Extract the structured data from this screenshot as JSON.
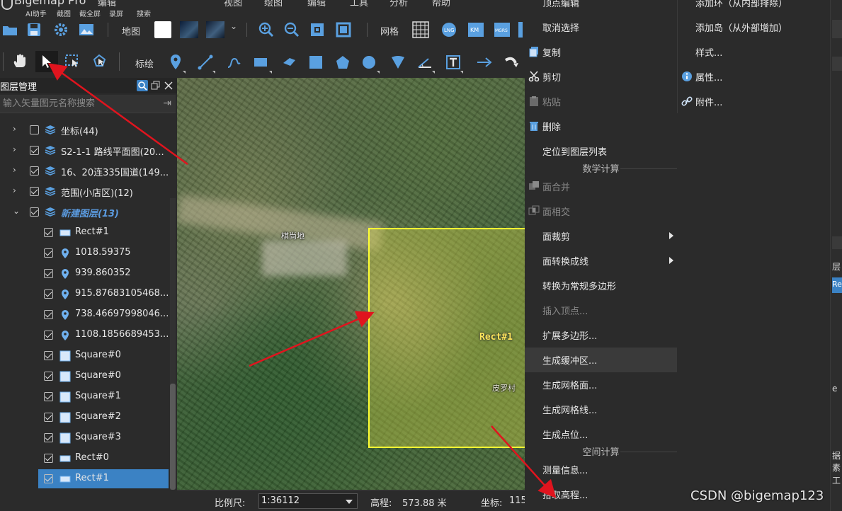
{
  "app": {
    "name": "Bigemap Pro"
  },
  "top_menu": {
    "items": [
      "编辑",
      "视图",
      "绘图",
      "编辑",
      "工具",
      "分析",
      "帮助"
    ],
    "quick": [
      "AI助手",
      "截图",
      "截全屏",
      "录屏",
      "搜索"
    ]
  },
  "toolbar1": {
    "map_label": "地图",
    "grid_label": "网格"
  },
  "toolbar2": {
    "mark_label": "标绘"
  },
  "layer_panel": {
    "title": "图层管理",
    "search_placeholder": "输入矢量图元名称搜索",
    "rows": [
      {
        "label": "坐标(44)",
        "checked": false,
        "type": "group"
      },
      {
        "label": "S2-1-1 路线平面图(20...",
        "checked": true,
        "type": "group"
      },
      {
        "label": "16、20连335国道(149...",
        "checked": true,
        "type": "group"
      },
      {
        "label": "范围(小店区)(12)",
        "checked": true,
        "type": "group"
      },
      {
        "label": "新建图层(13)",
        "checked": true,
        "type": "group-open"
      },
      {
        "label": "Rect#1",
        "checked": true,
        "type": "rect"
      },
      {
        "label": "1018.59375",
        "checked": true,
        "type": "point"
      },
      {
        "label": "939.860352",
        "checked": true,
        "type": "point"
      },
      {
        "label": "915.87683105468...",
        "checked": true,
        "type": "point"
      },
      {
        "label": "738.46697998046...",
        "checked": true,
        "type": "point"
      },
      {
        "label": "1108.1856689453...",
        "checked": true,
        "type": "point"
      },
      {
        "label": "Square#0",
        "checked": true,
        "type": "square"
      },
      {
        "label": "Square#0",
        "checked": true,
        "type": "square"
      },
      {
        "label": "Square#1",
        "checked": true,
        "type": "square"
      },
      {
        "label": "Square#2",
        "checked": true,
        "type": "square"
      },
      {
        "label": "Square#3",
        "checked": true,
        "type": "square"
      },
      {
        "label": "Rect#0",
        "checked": true,
        "type": "rect"
      },
      {
        "label": "Rect#1",
        "checked": true,
        "type": "rect",
        "selected": true
      }
    ]
  },
  "map": {
    "place_labels": [
      "棋尚地",
      "皮罗村"
    ],
    "rect_label": "Rect#1"
  },
  "context_menu": {
    "items": [
      {
        "label": "顶点编辑",
        "icon": "",
        "disabled": false
      },
      {
        "label": "取消选择",
        "icon": "",
        "disabled": false
      },
      {
        "label": "复制",
        "icon": "copy-icon",
        "disabled": false
      },
      {
        "label": "剪切",
        "icon": "scissors-icon",
        "disabled": false
      },
      {
        "label": "粘贴",
        "icon": "paste-icon",
        "disabled": true
      },
      {
        "label": "删除",
        "icon": "trash-icon",
        "disabled": false
      },
      {
        "label": "定位到图层列表",
        "icon": "",
        "disabled": false
      }
    ],
    "section_math": "数学计算",
    "math_items": [
      {
        "label": "面合并",
        "icon": "merge-icon",
        "disabled": true
      },
      {
        "label": "面相交",
        "icon": "intersect-icon",
        "disabled": true
      },
      {
        "label": "面裁剪",
        "submenu": true,
        "disabled": false
      },
      {
        "label": "面转换成线",
        "submenu": true,
        "disabled": false
      },
      {
        "label": "转换为常规多边形",
        "disabled": false
      },
      {
        "label": "插入顶点...",
        "disabled": true
      },
      {
        "label": "扩展多边形...",
        "disabled": false
      },
      {
        "label": "生成缓冲区...",
        "disabled": false,
        "hover": true
      },
      {
        "label": "生成网格面...",
        "disabled": false
      },
      {
        "label": "生成网格线...",
        "disabled": false
      },
      {
        "label": "生成点位...",
        "disabled": false
      }
    ],
    "section_space": "空间计算",
    "space_items": [
      {
        "label": "测量信息...",
        "disabled": false
      },
      {
        "label": "拾取高程...",
        "disabled": false
      }
    ]
  },
  "context_menu2": {
    "items": [
      {
        "label": "添加环（从内部排除）",
        "icon": ""
      },
      {
        "label": "添加岛（从外部增加）",
        "icon": ""
      },
      {
        "label": "样式...",
        "icon": ""
      },
      {
        "label": "属性...",
        "icon": "info-icon"
      },
      {
        "label": "附件...",
        "icon": "link-icon"
      }
    ]
  },
  "right_strip": {
    "labels": [
      "层",
      "Re",
      "e",
      "据素",
      "工"
    ]
  },
  "status_bar": {
    "scale_label": "比例尺:",
    "scale_value": "1:36112",
    "elev_label": "高程:",
    "elev_value": "573.88 米",
    "coord_label": "坐标:",
    "coord_value": "115"
  },
  "watermark": "CSDN @bigemap123",
  "colors": {
    "accent": "#3b82c4",
    "rect_border": "#ffff33",
    "arrow": "#e0141e"
  }
}
